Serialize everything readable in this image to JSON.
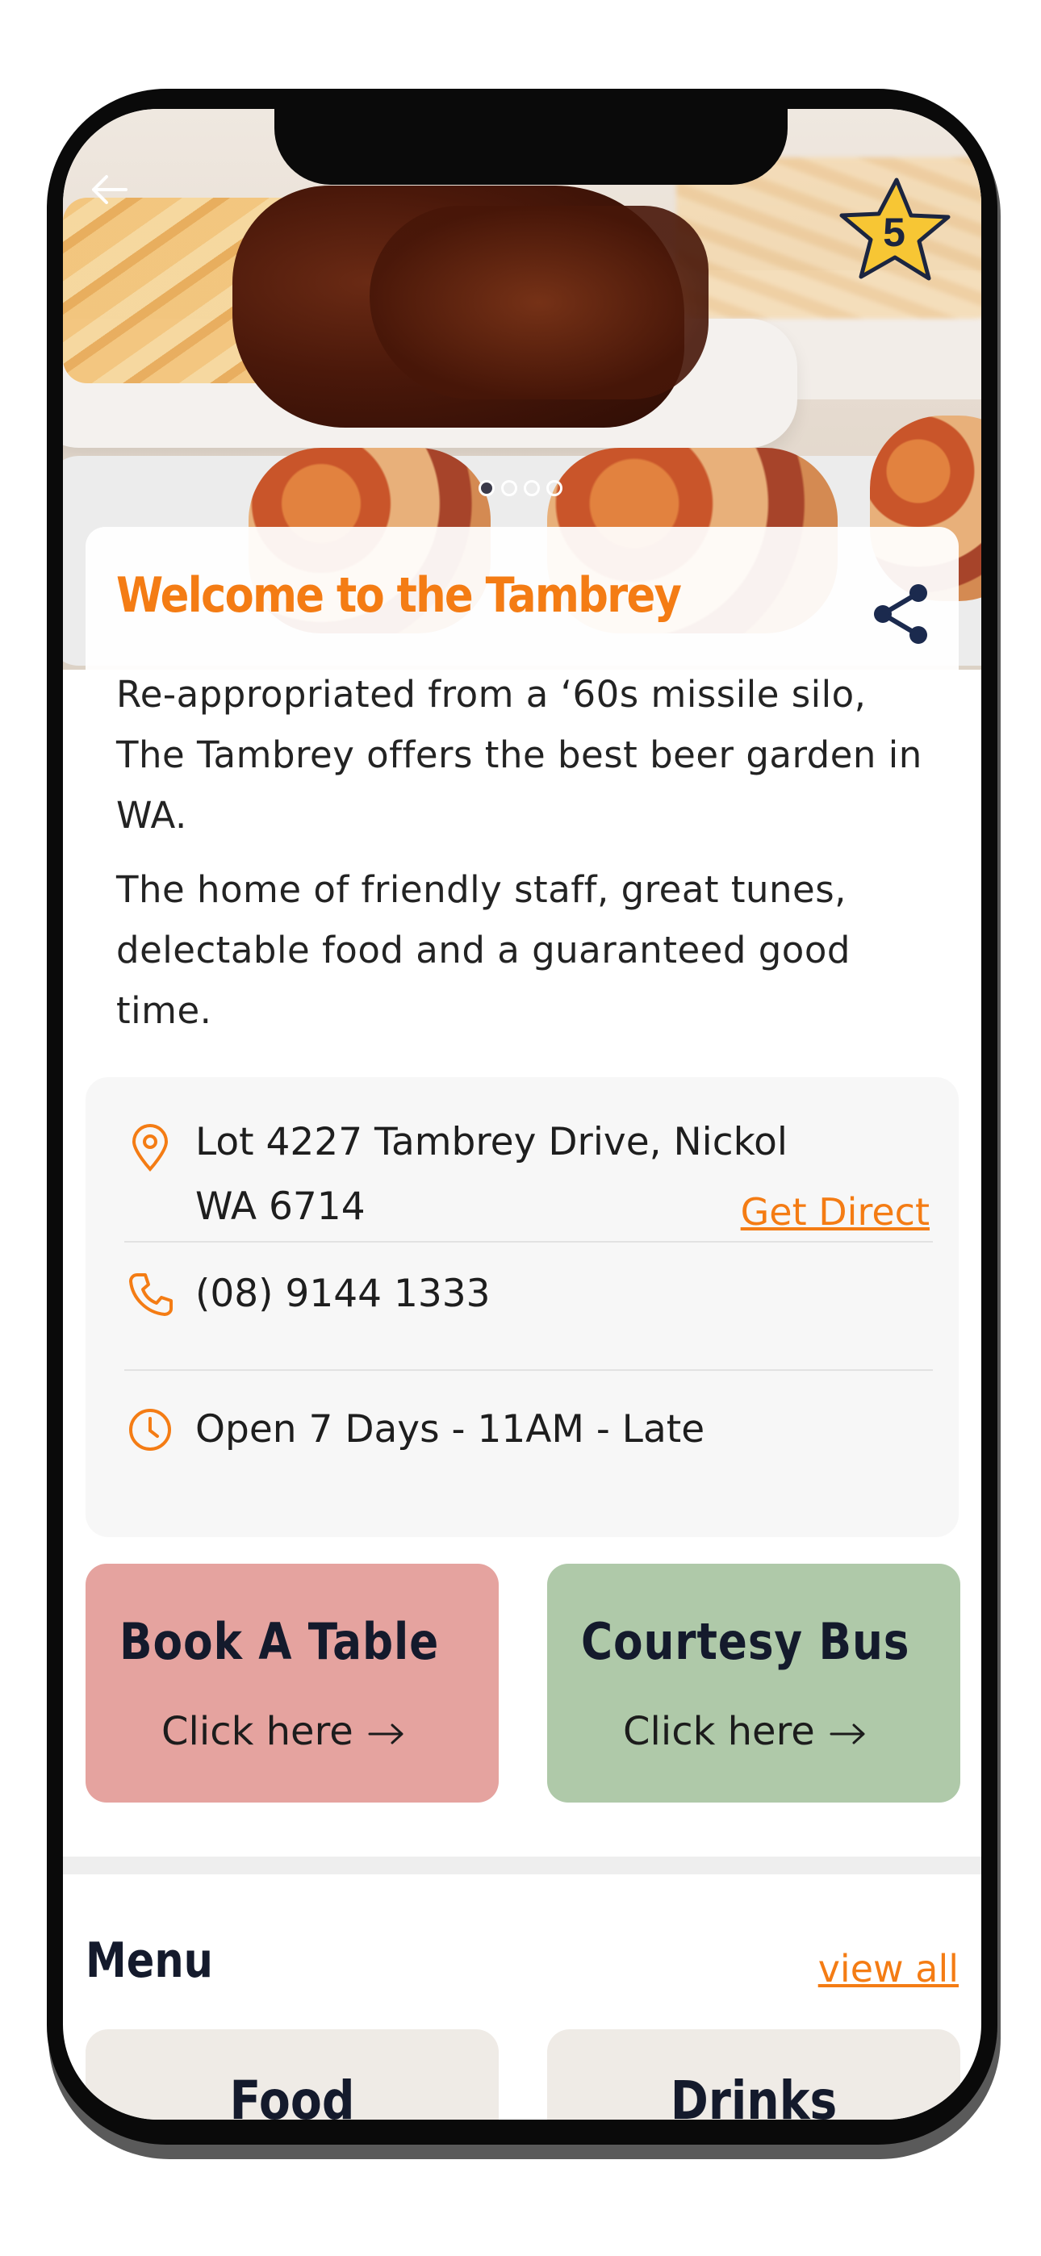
{
  "app": {
    "rating": "5",
    "accent_color": "#f47c14"
  },
  "header": {
    "back_icon": "arrow-left-icon",
    "carousel_count": 4,
    "carousel_active": 1
  },
  "welcome": {
    "title": "Welcome to the Tambrey",
    "share_icon": "share-icon",
    "paragraph1": "Re-appropriated from a ‘60s missile silo, The Tambrey offers the best beer garden in WA.",
    "paragraph2": "The home of friendly staff, great tunes, delectable food and a guaranteed good time."
  },
  "info": {
    "address_line1": "Lot 4227 Tambrey Drive, Nickol",
    "address_line2": "WA 6714",
    "directions_label": "Get Direct",
    "phone": "(08) 9144 1333",
    "hours": "Open 7 Days - 11AM - Late"
  },
  "actions": {
    "book": {
      "title": "Book A Table",
      "sub": "Click here",
      "color": "#e5a39f"
    },
    "bus": {
      "title": "Courtesy Bus",
      "sub": "Click here",
      "color": "#afc9a9"
    }
  },
  "menu": {
    "title": "Menu",
    "view_all": "view all",
    "cards": [
      "Food",
      "Drinks"
    ]
  }
}
